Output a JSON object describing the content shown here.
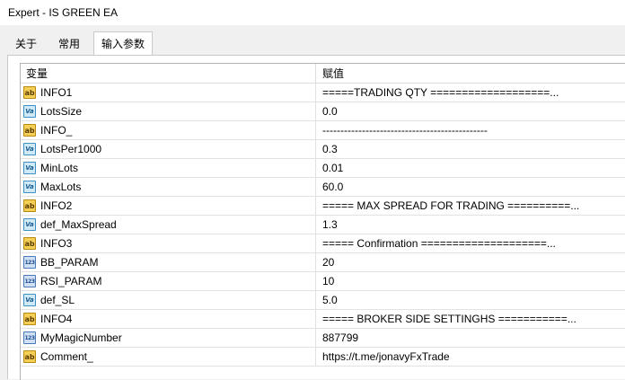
{
  "window": {
    "title": "Expert - IS GREEN EA"
  },
  "tabs": [
    {
      "label": "关于"
    },
    {
      "label": "常用"
    },
    {
      "label": "输入参数"
    }
  ],
  "table": {
    "headers": {
      "variable": "变量",
      "value": "赋值"
    },
    "rows": [
      {
        "type": "ab",
        "type_icon": "string-type-icon",
        "name": "INFO1",
        "value": "=====TRADING QTY ===================..."
      },
      {
        "type": "va",
        "type_icon": "double-type-icon",
        "name": "LotsSize",
        "value": "0.0"
      },
      {
        "type": "ab",
        "type_icon": "string-type-icon",
        "name": "INFO_",
        "value": "----------------------------------------------"
      },
      {
        "type": "va",
        "type_icon": "double-type-icon",
        "name": "LotsPer1000",
        "value": "0.3"
      },
      {
        "type": "va",
        "type_icon": "double-type-icon",
        "name": "MinLots",
        "value": "0.01"
      },
      {
        "type": "va",
        "type_icon": "double-type-icon",
        "name": "MaxLots",
        "value": "60.0"
      },
      {
        "type": "ab",
        "type_icon": "string-type-icon",
        "name": "INFO2",
        "value": "===== MAX SPREAD FOR TRADING ==========..."
      },
      {
        "type": "va",
        "type_icon": "double-type-icon",
        "name": "def_MaxSpread",
        "value": "1.3"
      },
      {
        "type": "ab",
        "type_icon": "string-type-icon",
        "name": "INFO3",
        "value": "===== Confirmation ====================..."
      },
      {
        "type": "123",
        "type_icon": "integer-type-icon",
        "name": "BB_PARAM",
        "value": "20"
      },
      {
        "type": "123",
        "type_icon": "integer-type-icon",
        "name": "RSI_PARAM",
        "value": "10"
      },
      {
        "type": "va",
        "type_icon": "double-type-icon",
        "name": "def_SL",
        "value": "5.0"
      },
      {
        "type": "ab",
        "type_icon": "string-type-icon",
        "name": "INFO4",
        "value": "===== BROKER SIDE SETTINGHS ===========..."
      },
      {
        "type": "123",
        "type_icon": "integer-type-icon",
        "name": "MyMagicNumber",
        "value": "887799"
      },
      {
        "type": "ab",
        "type_icon": "string-type-icon",
        "name": "Comment_",
        "value": "https://t.me/jonavyFxTrade"
      }
    ]
  }
}
